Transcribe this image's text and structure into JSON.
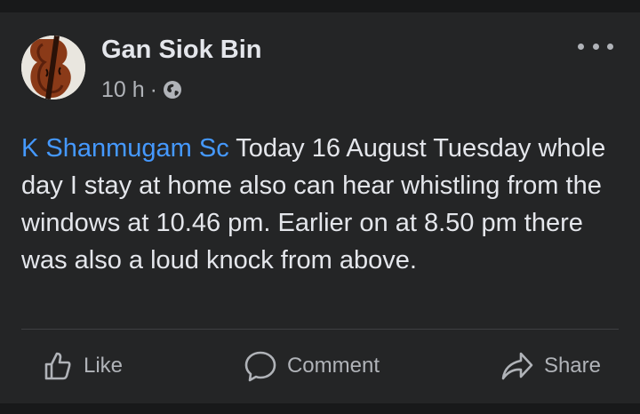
{
  "post": {
    "author": "Gan Siok Bin",
    "time": "10 h",
    "separator": "·",
    "privacy_icon": "globe-icon",
    "mention": "K Shanmugam Sc",
    "body": " Today 16 August Tuesday whole day I stay at home also can hear whistling from the windows at 10.46 pm. Earlier on at 8.50 pm there was also a loud knock from above."
  },
  "actions": {
    "like_label": "Like",
    "comment_label": "Comment",
    "share_label": "Share"
  },
  "colors": {
    "background": "#18191a",
    "card": "#242526",
    "text": "#e4e6eb",
    "muted": "#b0b3b8",
    "mention": "#4599ff"
  }
}
